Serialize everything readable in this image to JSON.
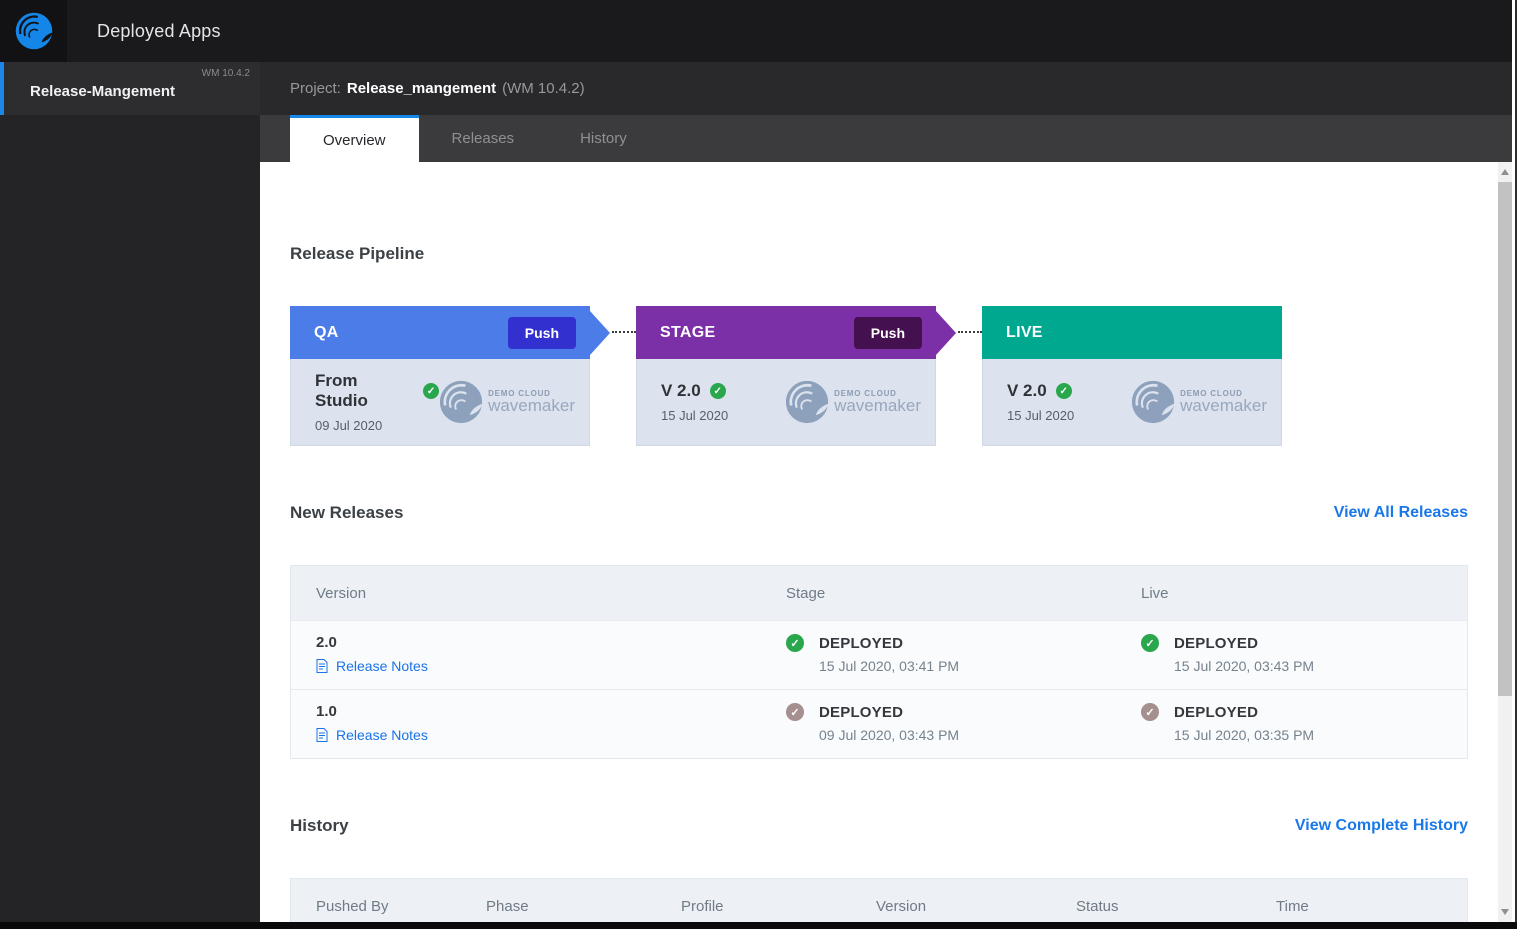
{
  "topbar": {
    "title": "Deployed Apps"
  },
  "sidebar": {
    "project": {
      "name": "Release-Mangement",
      "version": "WM 10.4.2"
    }
  },
  "header": {
    "label": "Project:",
    "name": "Release_mangement",
    "version": "(WM 10.4.2)"
  },
  "tabs": [
    {
      "label": "Overview",
      "active": true
    },
    {
      "label": "Releases",
      "active": false
    },
    {
      "label": "History",
      "active": false
    }
  ],
  "pipeline": {
    "title": "Release Pipeline",
    "brand": {
      "line1": "DEMO CLOUD",
      "line2": "wavemaker"
    },
    "stages": [
      {
        "name": "QA",
        "header_color": "#4b7ce8",
        "push_label": "Push",
        "push_color": "#3231cf",
        "version": "From Studio",
        "date": "09 Jul 2020"
      },
      {
        "name": "STAGE",
        "header_color": "#7c30a8",
        "push_label": "Push",
        "push_color": "#45104f",
        "version": "V 2.0",
        "date": "15 Jul 2020"
      },
      {
        "name": "LIVE",
        "header_color": "#00a88f",
        "version": "V 2.0",
        "date": "15 Jul 2020"
      }
    ]
  },
  "new_releases": {
    "title": "New Releases",
    "link": "View All Releases",
    "columns": [
      "Version",
      "Stage",
      "Live"
    ],
    "notes_label": "Release Notes",
    "rows": [
      {
        "version": "2.0",
        "stage": {
          "status": "DEPLOYED",
          "time": "15 Jul 2020, 03:41 PM",
          "color": "#2aa74c"
        },
        "live": {
          "status": "DEPLOYED",
          "time": "15 Jul 2020, 03:43 PM",
          "color": "#2aa74c"
        }
      },
      {
        "version": "1.0",
        "stage": {
          "status": "DEPLOYED",
          "time": "09 Jul 2020, 03:43 PM",
          "color": "#a58f8f"
        },
        "live": {
          "status": "DEPLOYED",
          "time": "15 Jul 2020, 03:35 PM",
          "color": "#a58f8f"
        }
      }
    ]
  },
  "history": {
    "title": "History",
    "link": "View Complete History",
    "columns": [
      "Pushed By",
      "Phase",
      "Profile",
      "Version",
      "Status",
      "Time"
    ]
  },
  "colors": {
    "accent_blue": "#1589ea",
    "link_blue": "#1a78e8",
    "status_green": "#2aa74c",
    "status_gray": "#a58f8f",
    "wave_blue": "#1486e8",
    "wave_gray": "#8da0bc"
  }
}
